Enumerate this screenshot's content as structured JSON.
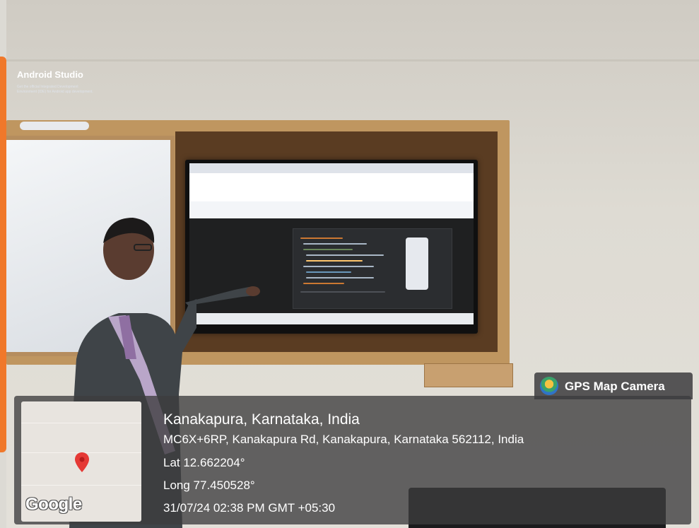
{
  "photo": {
    "screen_content": {
      "hero_title": "Android Studio",
      "hero_subtitle": "Get the official Integrated Development Environment (IDE) for Android app development."
    }
  },
  "overlay": {
    "badge": {
      "icon": "gps-map-camera-icon",
      "label": "GPS Map Camera"
    },
    "map": {
      "logo": "Google",
      "pin_icon": "map-pin-icon",
      "pin_color": "#e53935"
    },
    "location_title": "Kanakapura, Karnataka, India",
    "address": "MC6X+6RP, Kanakapura Rd, Kanakapura, Karnataka 562112, India",
    "latitude": "Lat 12.662204°",
    "longitude": "Long 77.450528°",
    "timestamp": "31/07/24 02:38 PM GMT +05:30"
  }
}
